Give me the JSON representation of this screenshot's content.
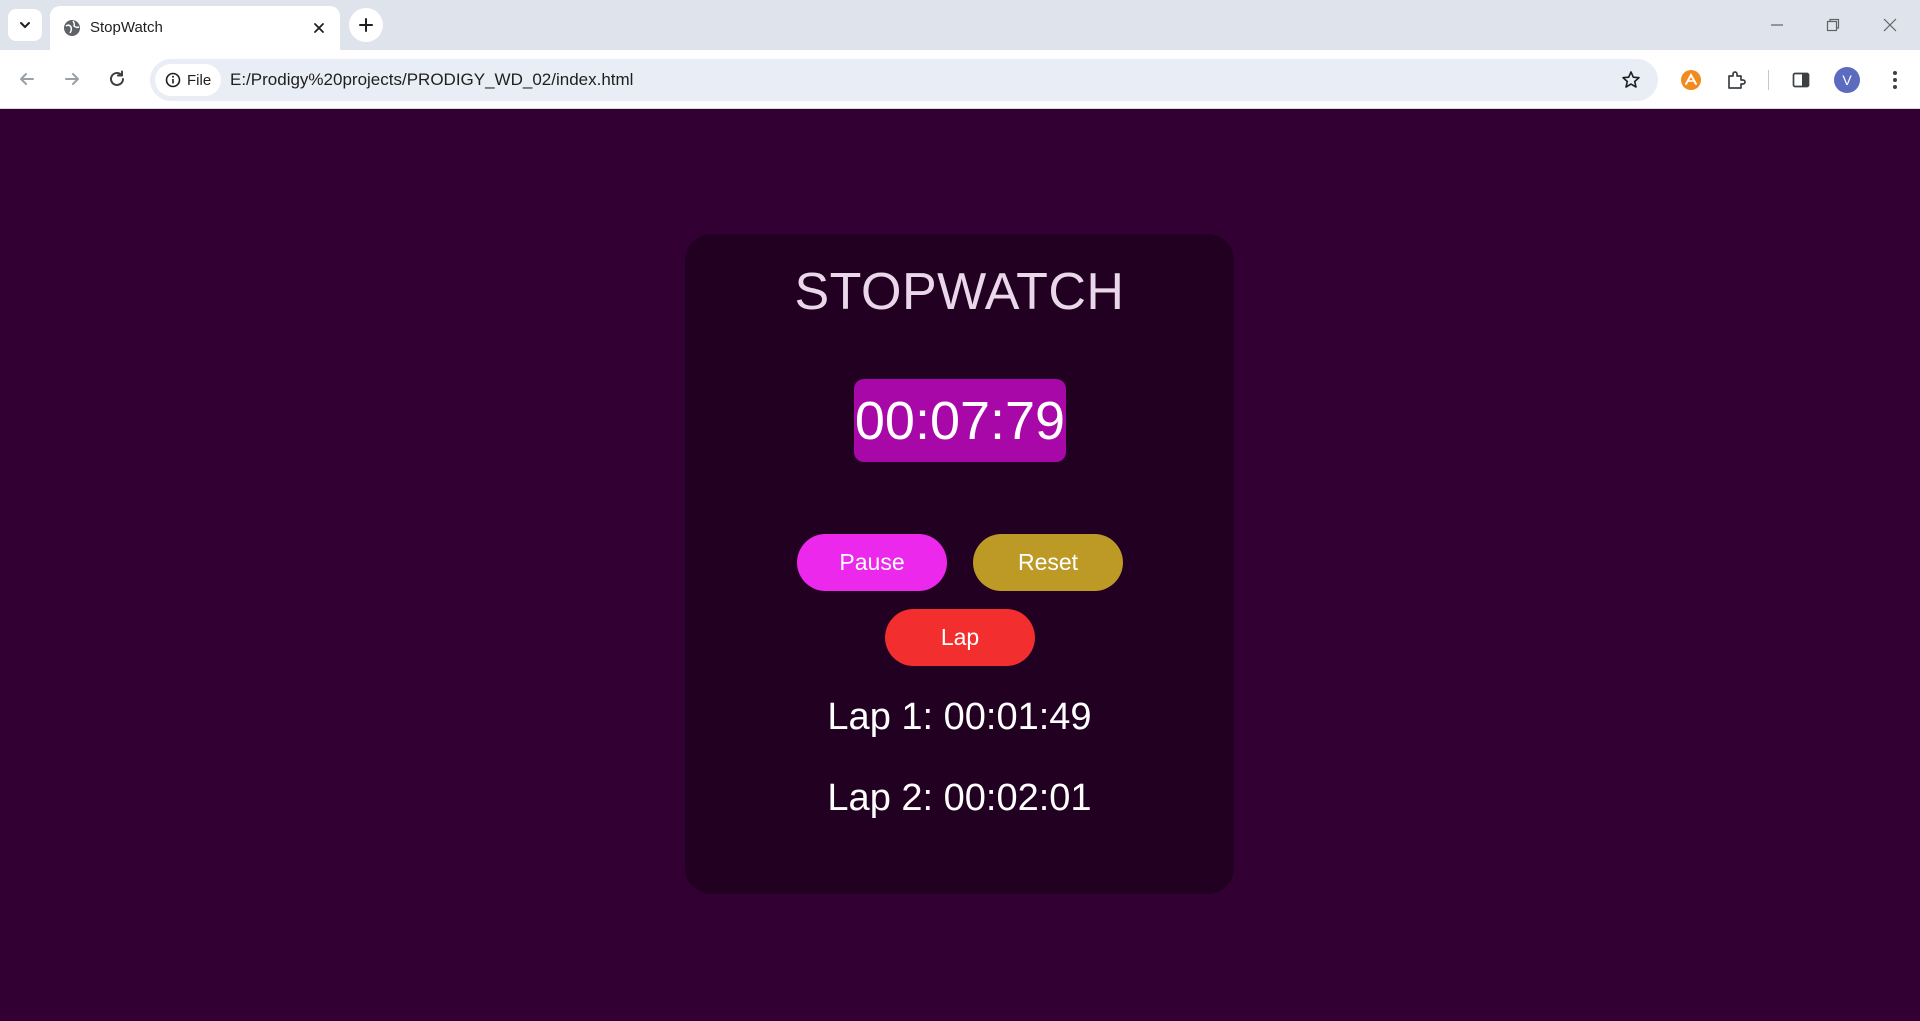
{
  "browser": {
    "tab_title": "StopWatch",
    "site_chip_label": "File",
    "url": "E:/Prodigy%20projects/PRODIGY_WD_02/index.html",
    "avatar_letter": "V"
  },
  "app": {
    "title": "STOPWATCH",
    "timer": "00:07:79",
    "buttons": {
      "pause": "Pause",
      "reset": "Reset",
      "lap": "Lap"
    },
    "laps": [
      "Lap 1: 00:01:49",
      "Lap 2: 00:02:01"
    ]
  },
  "colors": {
    "page_bg": "#330033",
    "card_bg": "#220022",
    "timer_bg": "#a808a8",
    "pause_btn": "#ec28ec",
    "reset_btn": "#bd9a26",
    "lap_btn": "#f22e2e"
  }
}
